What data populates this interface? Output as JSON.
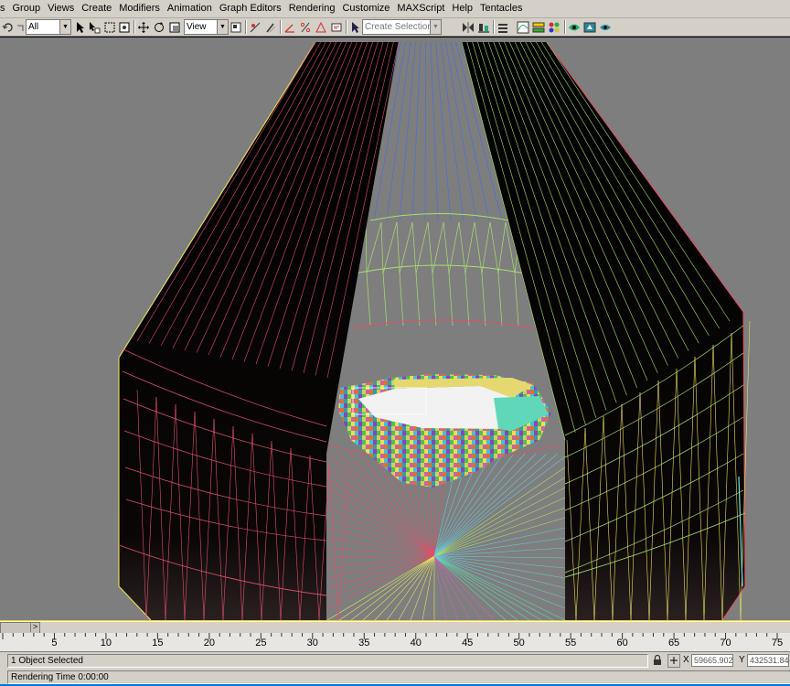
{
  "menubar": {
    "items": [
      "s",
      "Group",
      "Views",
      "Create",
      "Modifiers",
      "Animation",
      "Graph Editors",
      "Rendering",
      "Customize",
      "MAXScript",
      "Help",
      "Tentacles"
    ]
  },
  "toolbar": {
    "selection_filter": "All",
    "reference_coord": "View",
    "named_selection_placeholder": "Create Selection Set"
  },
  "timeline": {
    "frame_indicator": "",
    "ticks": [
      "5",
      "10",
      "15",
      "20",
      "25",
      "30",
      "35",
      "40",
      "45",
      "50",
      "55",
      "60",
      "65",
      "70",
      "75"
    ],
    "next_arrow": ">"
  },
  "status": {
    "selection_text": "1 Object Selected",
    "render_time_text": "Rendering Time  0:00:00",
    "x_label": "X",
    "x_value": "59665.902",
    "y_label": "Y",
    "y_value": "432531.84"
  },
  "colors": {
    "viewport_bg": "#7e7e7e",
    "active_border": "#ffd400",
    "mesh_fill": "#000000",
    "wire_red": "#e0506a",
    "wire_yellow": "#e8e060",
    "wire_green": "#a8e070",
    "wire_blue": "#4a70d8"
  }
}
